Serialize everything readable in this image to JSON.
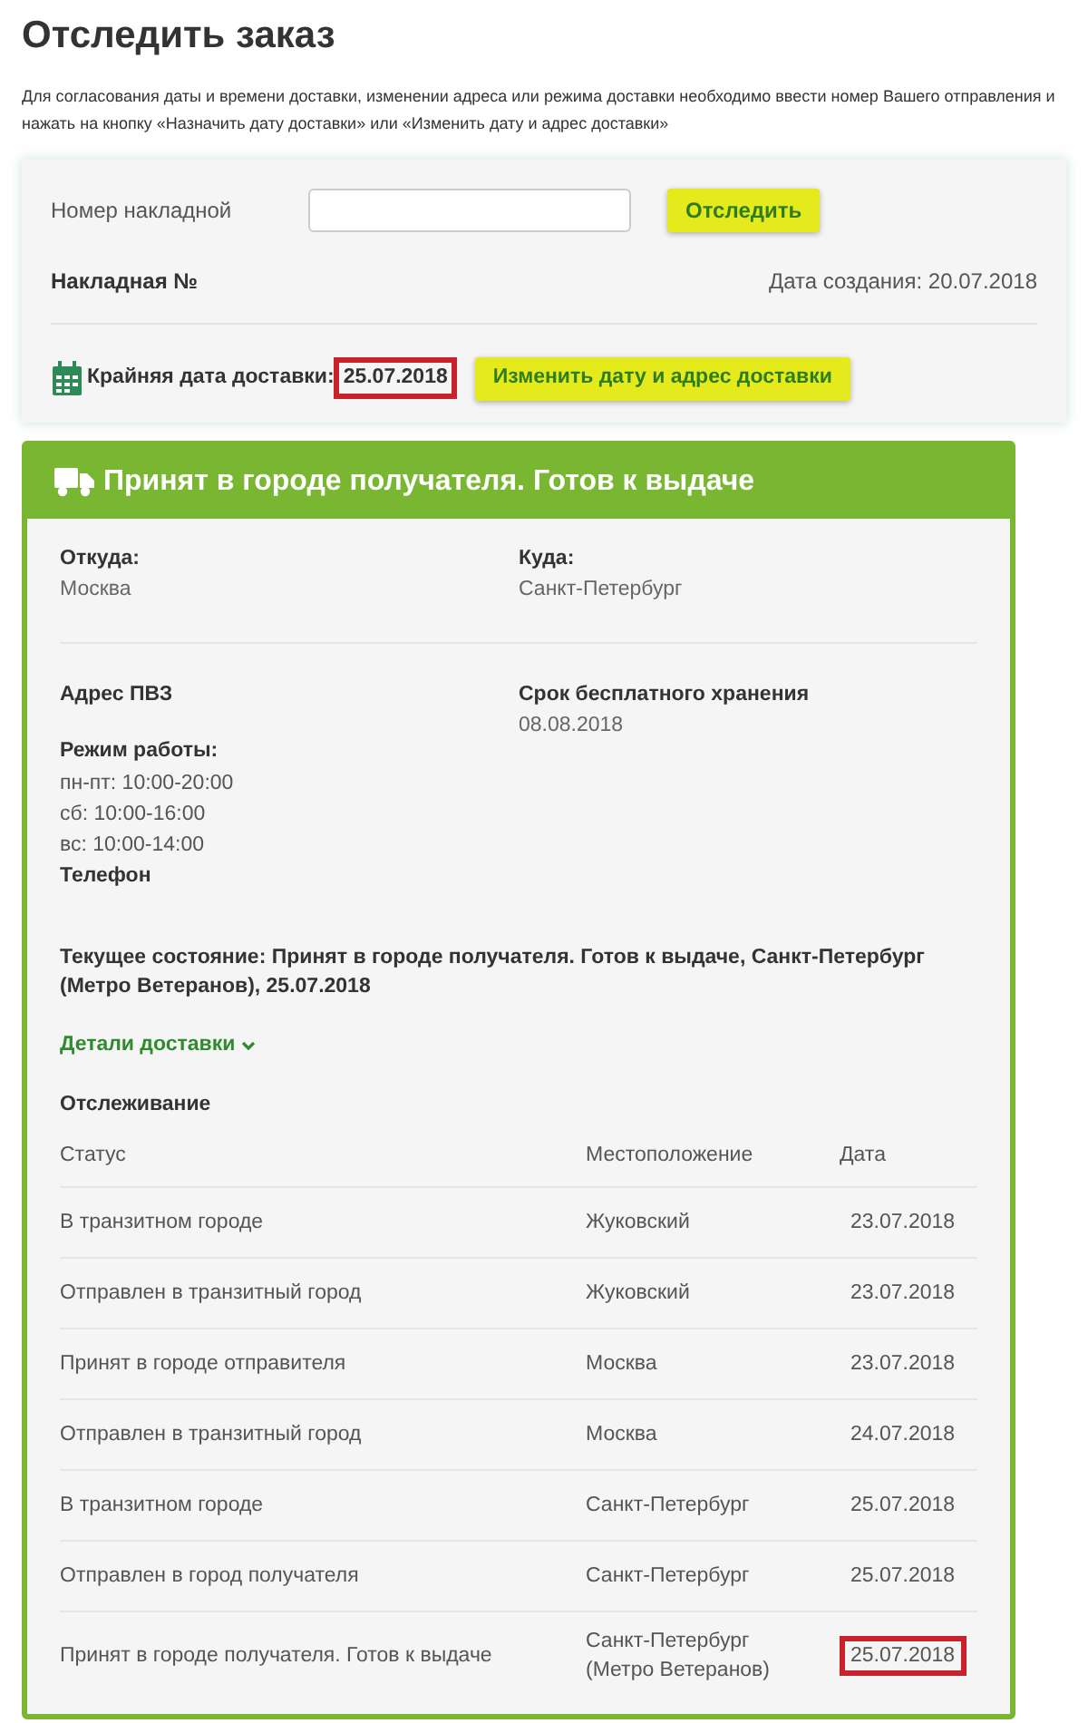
{
  "title": "Отследить заказ",
  "description": "Для согласования даты и времени доставки, изменении адреса или режима доставки необходимо ввести номер Вашего отправления и нажать на кнопку «Назначить дату доставки» или «Изменить дату и адрес доставки»",
  "form": {
    "label": "Номер накладной",
    "button": "Отследить"
  },
  "waybill": {
    "label": "Накладная №",
    "created": "Дата создания: 20.07.2018"
  },
  "deadline": {
    "label": "Крайняя дата доставки:",
    "date": "25.07.2018",
    "highlighted": true,
    "button": "Изменить дату и адрес доставки"
  },
  "status_card": {
    "title": "Принят в городе получателя. Готов к выдаче",
    "from": {
      "label": "Откуда:",
      "value": "Москва"
    },
    "to": {
      "label": "Куда:",
      "value": "Санкт-Петербург"
    },
    "pickup_address": {
      "label": "Адрес ПВЗ"
    },
    "storage": {
      "label": "Срок бесплатного хранения",
      "value": "08.08.2018"
    },
    "hours": {
      "label": "Режим работы:",
      "lines": [
        "пн-пт: 10:00-20:00",
        "сб: 10:00-16:00",
        "вс: 10:00-14:00"
      ]
    },
    "phone": {
      "label": "Телефон"
    },
    "current_state": "**Текущее состояние:** **Принят в городе получателя. Готов к выдаче, Санкт-Петербург (Метро Ветеранов), 25.07.2018**",
    "details_link": "Детали доставки",
    "tracking": {
      "title": "Отслеживание",
      "columns": [
        "Статус",
        "Местоположение",
        "Дата"
      ],
      "rows": [
        {
          "status": "В транзитном городе",
          "location": "Жуковский",
          "date": "23.07.2018",
          "highlighted": false
        },
        {
          "status": "Отправлен в транзитный город",
          "location": "Жуковский",
          "date": "23.07.2018",
          "highlighted": false
        },
        {
          "status": "Принят в городе отправителя",
          "location": "Москва",
          "date": "23.07.2018",
          "highlighted": false
        },
        {
          "status": "Отправлен в транзитный город",
          "location": "Москва",
          "date": "24.07.2018",
          "highlighted": false
        },
        {
          "status": "В транзитном городе",
          "location": "Санкт-Петербург",
          "date": "25.07.2018",
          "highlighted": false
        },
        {
          "status": "Отправлен в город получателя",
          "location": "Санкт-Петербург",
          "date": "25.07.2018",
          "highlighted": false
        },
        {
          "status": "Принят в городе получателя. Готов к выдаче",
          "location": "Санкт-Петербург (Метро Ветеранов)",
          "date": "25.07.2018",
          "highlighted": true
        }
      ]
    }
  }
}
